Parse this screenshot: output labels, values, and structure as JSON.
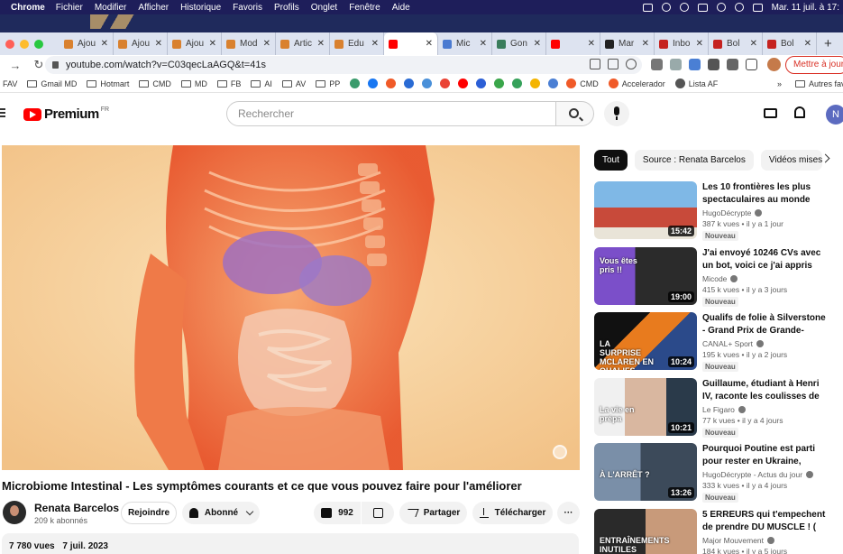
{
  "menubar": {
    "app": "Chrome",
    "items": [
      "Fichier",
      "Modifier",
      "Afficher",
      "Historique",
      "Favoris",
      "Profils",
      "Onglet",
      "Fenêtre",
      "Aide"
    ],
    "clock": "Mar. 11 juil. à 17:"
  },
  "tabs": [
    {
      "label": "Ajou",
      "color": "#d9812f"
    },
    {
      "label": "Ajou",
      "color": "#d9812f"
    },
    {
      "label": "Ajou",
      "color": "#d9812f"
    },
    {
      "label": "Mod",
      "color": "#d9812f"
    },
    {
      "label": "Artic",
      "color": "#d9812f"
    },
    {
      "label": "Edu",
      "color": "#d9812f"
    },
    {
      "label": "",
      "color": "#ff0000",
      "active": true
    },
    {
      "label": "Mic",
      "color": "#4b7bd1"
    },
    {
      "label": "Gon",
      "color": "#3a7d5c"
    },
    {
      "label": "",
      "color": "#ff0000"
    },
    {
      "label": "Mar",
      "color": "#222222"
    },
    {
      "label": "Inbo",
      "color": "#c5221f"
    },
    {
      "label": "Bol",
      "color": "#c5221f"
    },
    {
      "label": "Bol",
      "color": "#c5221f"
    }
  ],
  "toolbar": {
    "url": "youtube.com/watch?v=C03qecLaAGQ&t=41s",
    "update_label": "Mettre à jour"
  },
  "bookmarks": {
    "items": [
      "FAV",
      "Gmail MD",
      "Hotmart",
      "CMD",
      "MD",
      "FB",
      "AI",
      "AV",
      "PP"
    ],
    "more": [
      "CMD",
      "Accelerador",
      "Lista AF"
    ],
    "overflow": "»",
    "other": "Autres fav"
  },
  "youtube": {
    "logo": "Premium",
    "region": "FR",
    "search_placeholder": "Rechercher",
    "avatar_letter": "N"
  },
  "video": {
    "title": "Microbiome Intestinal - Les symptômes courants et ce que vous pouvez faire pour l'améliorer",
    "channel": "Renata Barcelos",
    "subscribers": "209 k abonnés",
    "join_label": "Rejoindre",
    "subscribed_label": "Abonné",
    "likes": "992",
    "share_label": "Partager",
    "download_label": "Télécharger",
    "views": "7 780 vues",
    "date": "7 juil. 2023"
  },
  "chips": [
    "Tout",
    "Source : Renata Barcelos",
    "Vidéos mises"
  ],
  "recommendations": [
    {
      "title": "Les 10 frontières les plus spectaculaires au monde",
      "channel": "HugoDécrypte",
      "views": "387 k vues",
      "age": "il y a 1 jour",
      "badge": "Nouveau",
      "duration": "15:42",
      "thumb_label": ""
    },
    {
      "title": "J'ai envoyé 10246 CVs avec un bot, voici ce j'ai appris",
      "channel": "Micode",
      "views": "415 k vues",
      "age": "il y a 3 jours",
      "badge": "Nouveau",
      "duration": "19:00",
      "thumb_label": "Vous êtes pris !!"
    },
    {
      "title": "Qualifs de folie à Silverstone - Grand Prix de Grande-Bretagn...",
      "channel": "CANAL+ Sport",
      "views": "195 k vues",
      "age": "il y a 2 jours",
      "badge": "Nouveau",
      "duration": "10:24",
      "thumb_label": "LA SURPRISE MCLAREN EN QUALIFS"
    },
    {
      "title": "Guillaume, étudiant à Henri IV, raconte les coulisses de la...",
      "channel": "Le Figaro",
      "views": "77 k vues",
      "age": "il y a 4 jours",
      "badge": "Nouveau",
      "duration": "10:21",
      "thumb_label": "La vie en prépa"
    },
    {
      "title": "Pourquoi Poutine est parti pour rester en Ukraine, nouveau...",
      "channel": "HugoDécrypte - Actus du jour",
      "views": "333 k vues",
      "age": "il y a 4 jours",
      "badge": "Nouveau",
      "duration": "13:26",
      "thumb_label": "À L'ARRÊT ?"
    },
    {
      "title": "5 ERREURS qui t'empechent de prendre DU MUSCLE ! ( les...",
      "channel": "Major Mouvement",
      "views": "184 k vues",
      "age": "il y a 5 jours",
      "badge": "",
      "duration": "",
      "thumb_label": "ENTRAÎNEMENTS INUTILES"
    }
  ]
}
